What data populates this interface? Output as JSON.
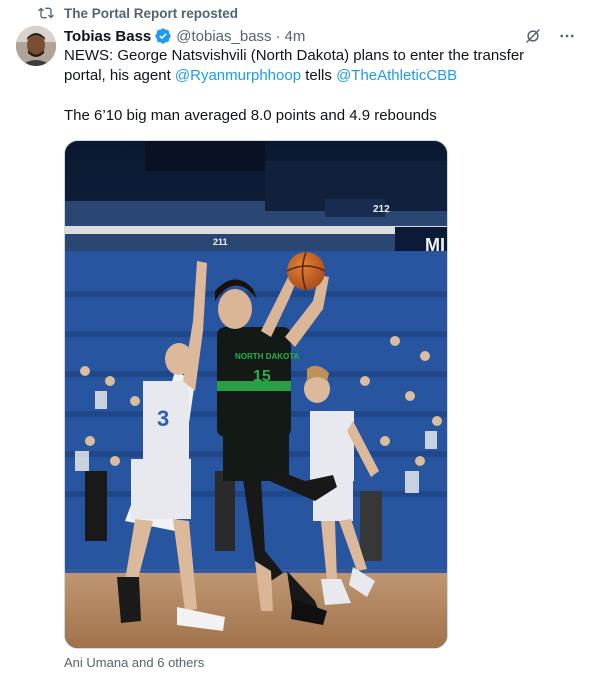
{
  "repost": {
    "text": "The Portal Report reposted",
    "icon": "repost-icon"
  },
  "author": {
    "name": "Tobias Bass",
    "handle": "@tobias_bass",
    "separator": "·",
    "time": "4m",
    "verified_color": "#1d9bf0"
  },
  "actions": {
    "grok_icon": "grok-icon",
    "more_icon": "more-icon"
  },
  "tweet": {
    "line1_pre": "NEWS: George Natsvishvili (North Dakota) plans to enter the transfer portal, his agent ",
    "mention1": "@Ryanmurphhoop",
    "line1_mid": " tells ",
    "mention2": "@TheAthleticCBB",
    "line2": "The 6’10 big man averaged 8.0 points and 4.9 rebounds"
  },
  "media": {
    "jersey_text": "NORTH DAKOTA",
    "jersey_number": "15",
    "section_212": "212",
    "section_211": "211",
    "arena_sign": "MI"
  },
  "footer": {
    "likers": "Ani Umana and 6 others"
  },
  "colors": {
    "link": "#1d9bf0",
    "muted": "#536471"
  }
}
